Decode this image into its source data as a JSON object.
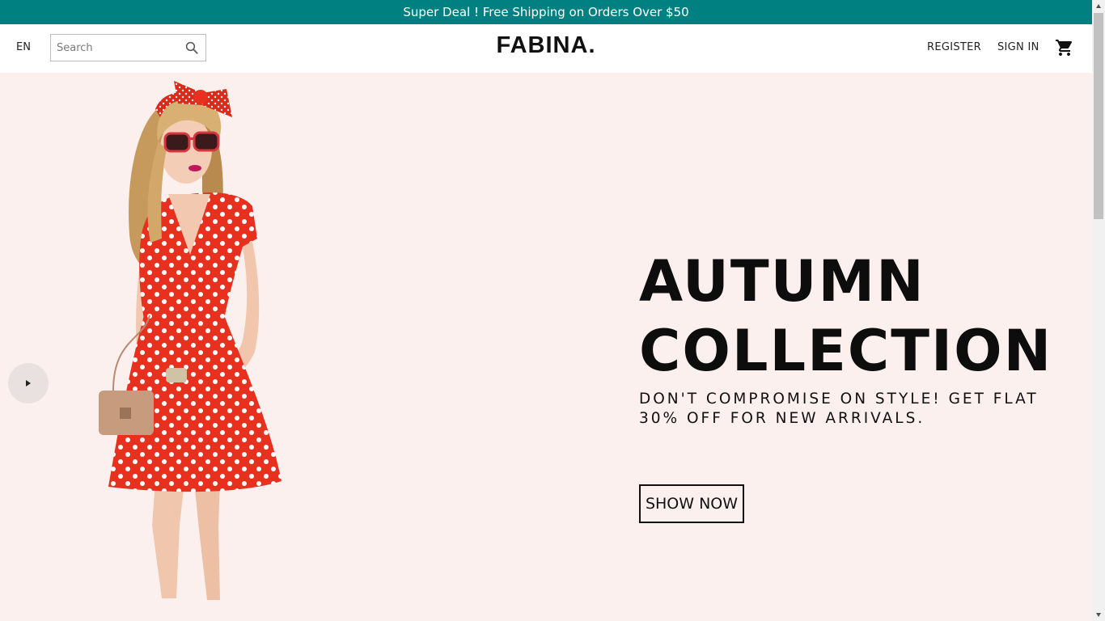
{
  "announcement": {
    "text": "Super Deal ! Free Shipping on Orders Over $50"
  },
  "header": {
    "language": "EN",
    "search": {
      "placeholder": "Search",
      "value": ""
    },
    "logo": "FABINA.",
    "register_label": "REGISTER",
    "signin_label": "SIGN IN",
    "icons": {
      "search": "search-icon",
      "cart": "cart-icon"
    }
  },
  "hero": {
    "title": "AUTUMN COLLECTION",
    "subtitle": "DON'T COMPROMISE ON STYLE! GET FLAT 30% OFF FOR NEW ARRIVALS.",
    "cta_label": "SHOW NOW",
    "background_color": "#fcf0ee",
    "image_subject": "woman in red polka-dot dress with bow headband and sunglasses",
    "slider_arrow": "arrow-right-icon"
  },
  "colors": {
    "accent": "#008080",
    "dress_red": "#e8301e",
    "text": "#111111"
  }
}
